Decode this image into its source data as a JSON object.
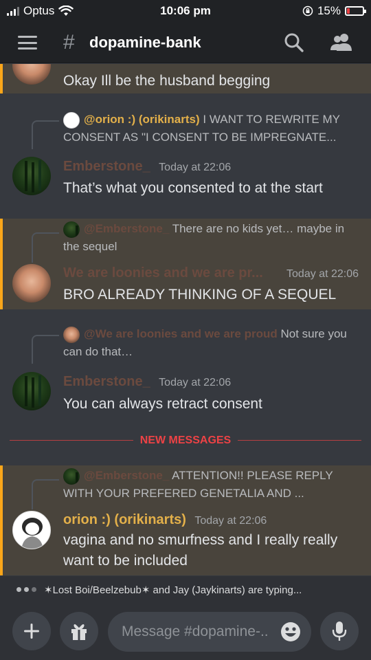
{
  "status_bar": {
    "carrier": "Optus",
    "time": "10:06 pm",
    "battery": "15%",
    "battery_level": 0.15
  },
  "header": {
    "channel_name": "dopamine-bank",
    "hash_symbol": "#",
    "icons": [
      "menu-icon",
      "search-icon",
      "members-icon"
    ]
  },
  "messages": [
    {
      "id": "m1",
      "text": "Okay Ill be the husband begging",
      "highlighted": true
    },
    {
      "id": "m2",
      "reply": {
        "name": "@orion :) (orikinarts)",
        "text": "I WANT TO REWRITE MY CONSENT AS \"I  CONSENT TO BE IMPREGNATE..."
      },
      "author": "Emberstone_",
      "timestamp": "Today at 22:06",
      "text": "That’s what you consented to at the start",
      "highlighted": false
    },
    {
      "id": "m3",
      "reply": {
        "name": "@Emberstone_",
        "text": "There are no kids yet… maybe in the sequel"
      },
      "author": "We are loonies and we are pr...",
      "timestamp": "Today at 22:06",
      "text": "BRO ALREADY THINKING OF A SEQUEL",
      "highlighted": true
    },
    {
      "id": "m4",
      "reply": {
        "name": "@We are loonies and we are proud",
        "text": "Not sure you can do that…"
      },
      "author": "Emberstone_",
      "timestamp": "Today at 22:06",
      "text": "You can always retract consent",
      "highlighted": false
    },
    {
      "id": "m5",
      "reply": {
        "name": "@Emberstone_",
        "text": "ATTENTION!! PLEASE REPLY WITH YOUR PREFERED GENETALIA AND ..."
      },
      "author": "orion :) (orikinarts)",
      "timestamp": "Today at 22:06",
      "text": "vagina and no smurfness and I really really want to be included",
      "highlighted": true
    }
  ],
  "divider_label": "NEW MESSAGES",
  "typing": {
    "text": "✶Lost Boi/Beelzebub✶ and Jay (Jaykinarts) are typing..."
  },
  "composer": {
    "placeholder": "Message #dopamine-..",
    "icons": [
      "plus-icon",
      "gift-icon",
      "emoji-icon",
      "microphone-icon"
    ]
  },
  "colors": {
    "background": "#36393f",
    "highlight": "#49443c",
    "highlight_border": "#faa61a",
    "emberstone": "#6b4a3f",
    "loonies": "#6b4a3f",
    "orion": "#e3b04a",
    "new_messages": "#ed4245"
  }
}
